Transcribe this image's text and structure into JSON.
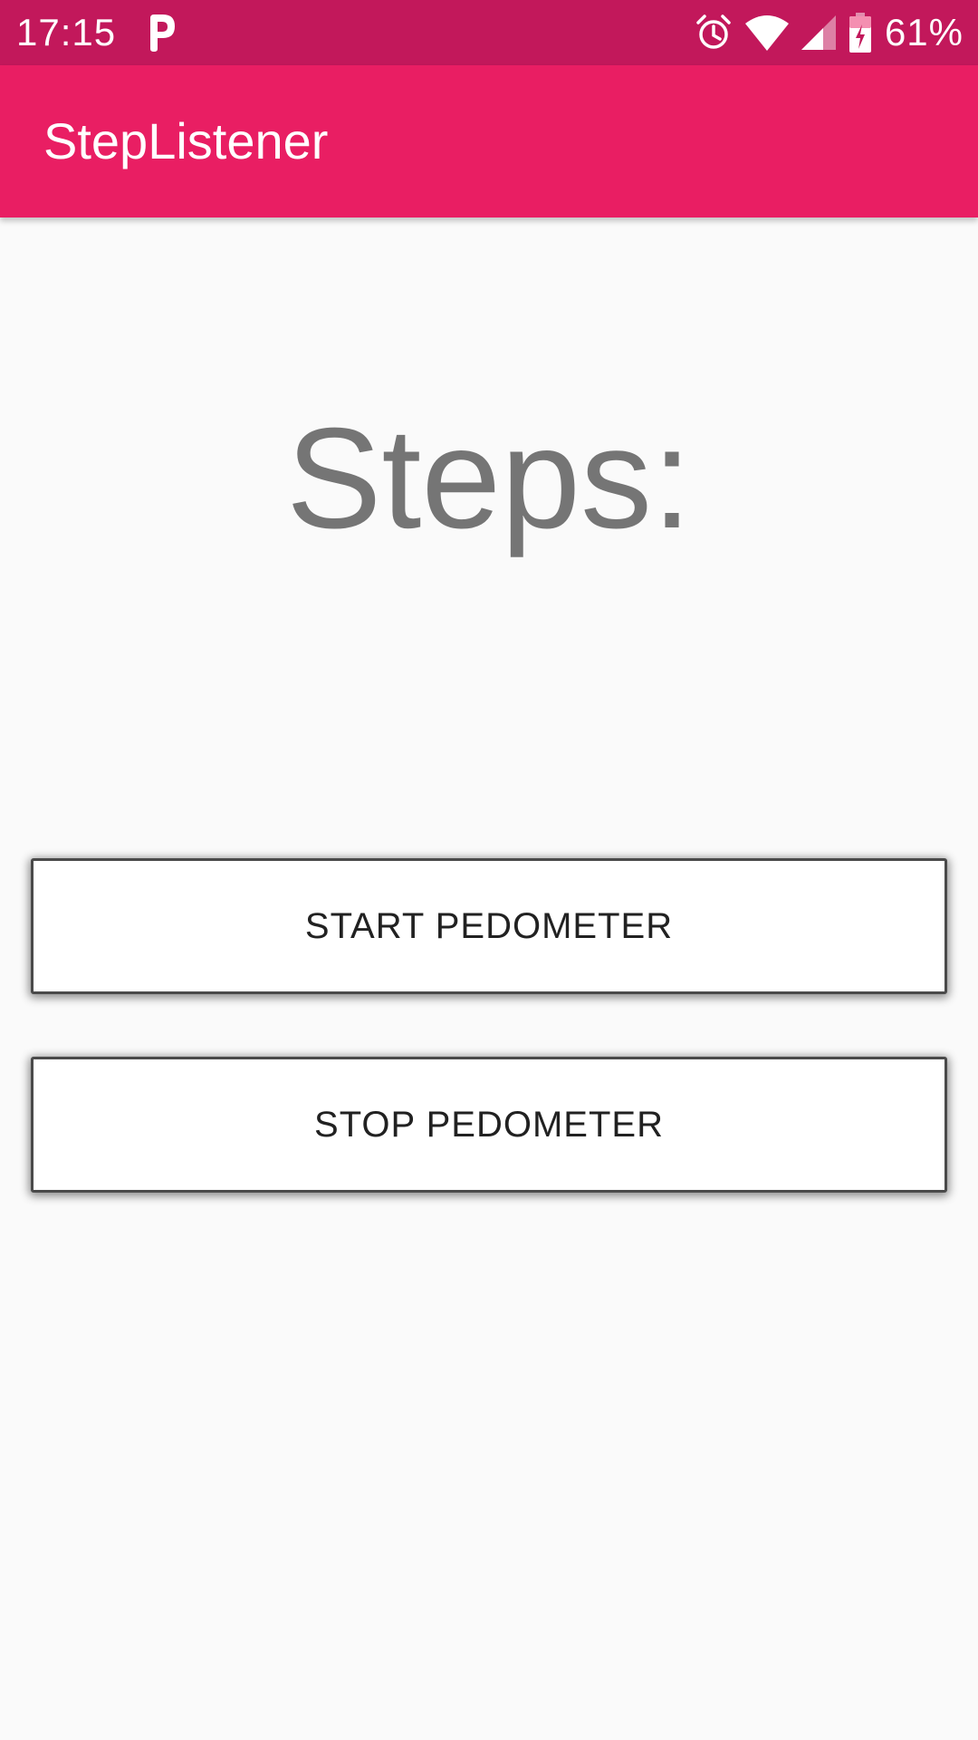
{
  "status_bar": {
    "time": "17:15",
    "battery_percent": "61%",
    "left_icon": "p-notification-icon",
    "right_icons": [
      "alarm-icon",
      "wifi-icon",
      "cell-signal-icon",
      "battery-charging-icon"
    ],
    "color": "#c2185b"
  },
  "app_bar": {
    "title": "StepListener",
    "color": "#e91e63"
  },
  "main": {
    "steps_label": "Steps:"
  },
  "buttons": {
    "start_label": "START PEDOMETER",
    "stop_label": "STOP PEDOMETER"
  }
}
